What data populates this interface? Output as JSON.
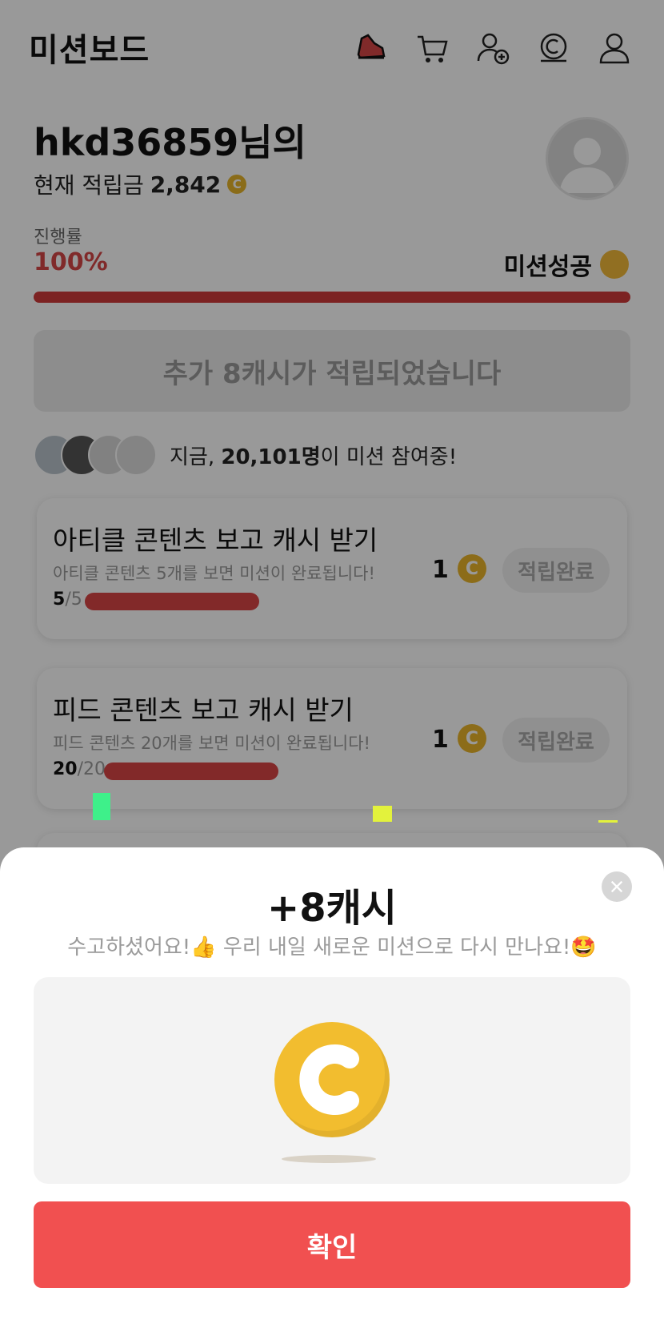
{
  "header": {
    "title": "미션보드",
    "icons": [
      "shoe-icon",
      "cart-icon",
      "add-user-icon",
      "cash-icon",
      "user-icon"
    ]
  },
  "profile": {
    "name": "hkd36859님의",
    "points_label": "현재 적립금",
    "points_value": "2,842",
    "coin_symbol": "C"
  },
  "progress": {
    "label": "진행률",
    "percent_text": "100%",
    "fraction": 1.0,
    "status": "미션성공"
  },
  "banner": {
    "text": "추가 8캐시가 적립되었습니다"
  },
  "participants": {
    "prefix": "지금, ",
    "count": "20,101명",
    "suffix": "이 미션 참여중!"
  },
  "missions": [
    {
      "title": "아티클 콘텐츠 보고 캐시 받기",
      "desc": "아티클 콘텐츠 5개를 보면 미션이 완료됩니다!",
      "done": "5",
      "total": "/5",
      "fraction": 1.0,
      "reward": "1",
      "coin": "C",
      "button": "적립완료"
    },
    {
      "title": "피드 콘텐츠 보고 캐시 받기",
      "desc": "피드 콘텐츠 20개를 보면 미션이 완료됩니다!",
      "done": "20",
      "total": "/20",
      "fraction": 1.0,
      "reward": "1",
      "coin": "C",
      "button": "적립완료"
    }
  ],
  "sheet": {
    "title": "+8캐시",
    "subtitle": "수고하셨어요!👍 우리 내일 새로운 미션으로 다시 만나요!🤩",
    "confirm_label": "확인"
  },
  "colors": {
    "accent": "#f15050",
    "progress": "#cf3a3a",
    "coin": "#f2bd2f"
  }
}
